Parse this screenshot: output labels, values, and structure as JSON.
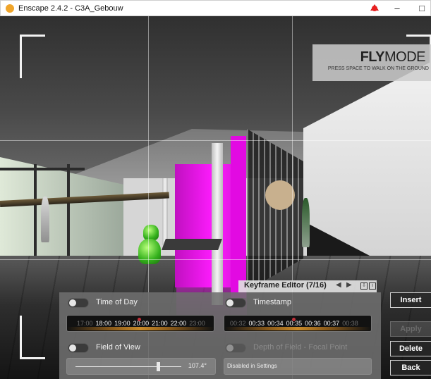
{
  "window": {
    "title": "Enscape 2.4.2 - C3A_Gebouw",
    "minimize": "–",
    "maximize": "□",
    "close": "✕"
  },
  "flymode": {
    "title_bold": "FLY",
    "title_light": "MODE",
    "subtitle": "PRESS SPACE TO WALK ON THE GROUND"
  },
  "keyframe_editor": {
    "title": "Keyframe Editor (7/16)",
    "prev": "◀",
    "next": "▶",
    "export_icon": "⇩",
    "info_icon": "i"
  },
  "settings": {
    "time_of_day": {
      "label": "Time of Day",
      "enabled": false,
      "ticks": [
        "17:00",
        "18:00",
        "19:00",
        "20:00",
        "21:00",
        "22:00",
        "23:00"
      ]
    },
    "timestamp": {
      "label": "Timestamp",
      "enabled": false,
      "ticks": [
        "00:32",
        "00:33",
        "00:34",
        "00:35",
        "00:36",
        "00:37",
        "00:38"
      ]
    },
    "field_of_view": {
      "label": "Field of View",
      "enabled": false,
      "value": "107.4°",
      "slider_fraction": 0.78
    },
    "depth_of_field": {
      "label": "Depth of Field - Focal Point",
      "enabled": false,
      "note": "Disabled in Settings"
    }
  },
  "actions": {
    "insert": "Insert",
    "apply": "Apply",
    "delete": "Delete",
    "back": "Back"
  },
  "colors": {
    "accent_magenta": "#ff1cff",
    "panel_bg": "#6e6e6e",
    "marker_red": "#c0303a",
    "timeline_glow": "#c88a2a"
  }
}
